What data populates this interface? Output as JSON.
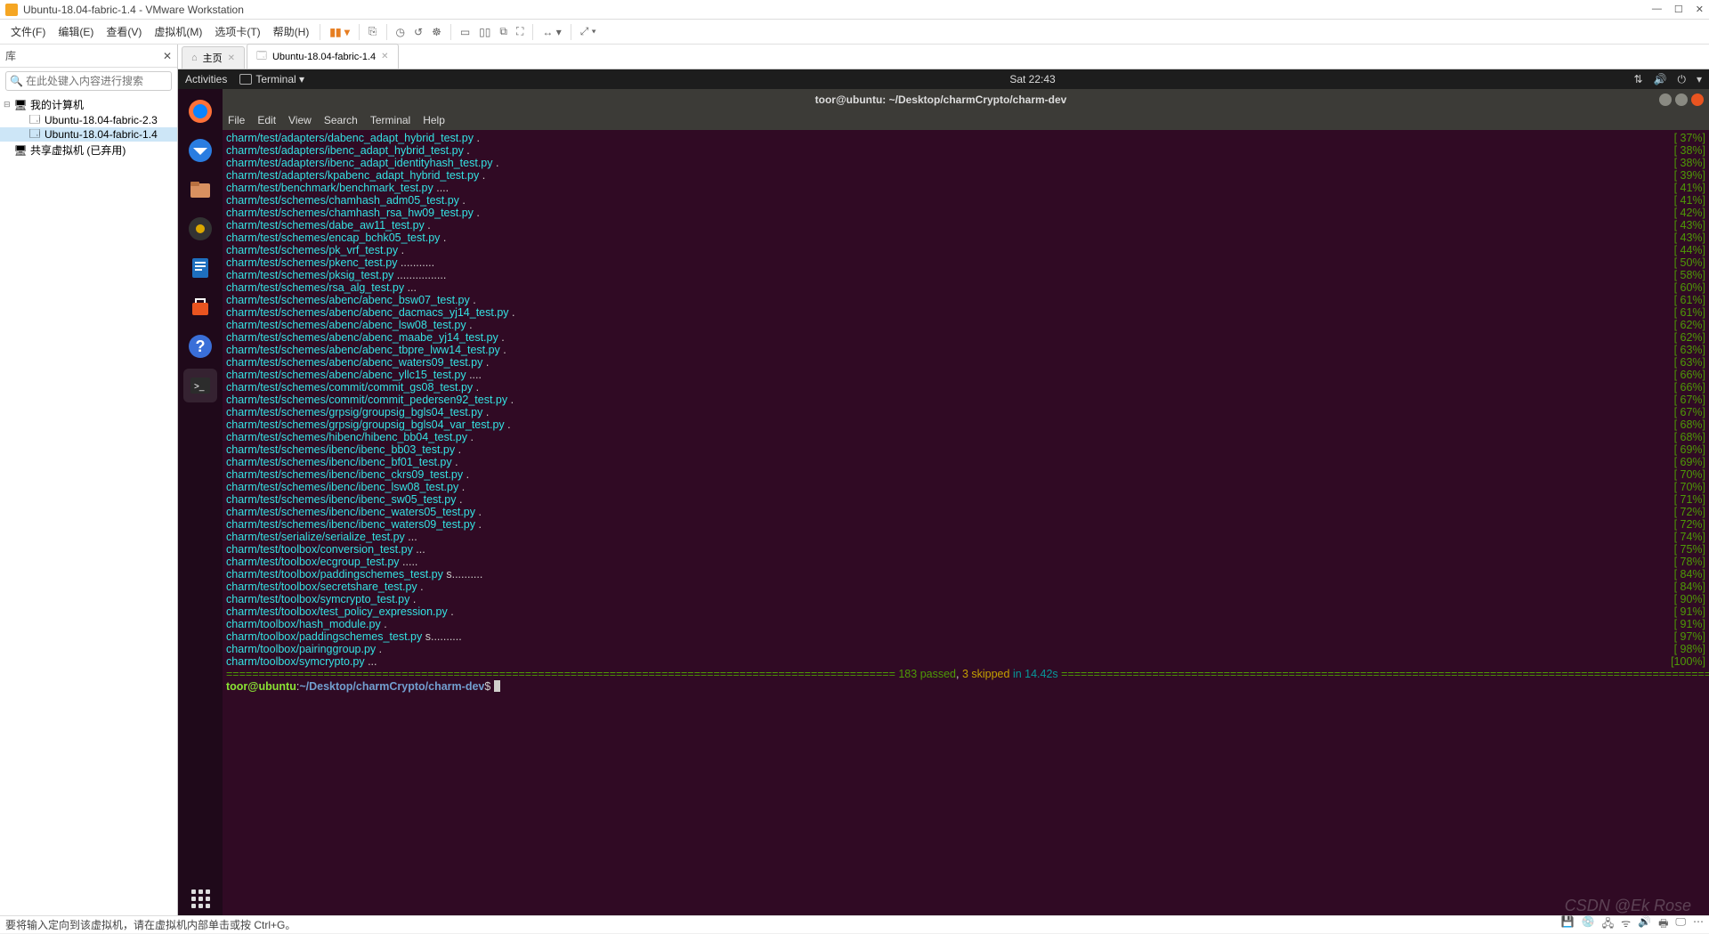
{
  "vmware": {
    "title": "Ubuntu-18.04-fabric-1.4 - VMware Workstation",
    "menu": [
      "文件(F)",
      "编辑(E)",
      "查看(V)",
      "虚拟机(M)",
      "选项卡(T)",
      "帮助(H)"
    ]
  },
  "sidebar": {
    "title": "库",
    "search_placeholder": "在此处键入内容进行搜索",
    "nodes": [
      {
        "indent": 0,
        "tw": "⊟",
        "icon": "pc",
        "label": "我的计算机"
      },
      {
        "indent": 1,
        "tw": "",
        "icon": "vm",
        "label": "Ubuntu-18.04-fabric-2.3"
      },
      {
        "indent": 1,
        "tw": "",
        "icon": "vm",
        "label": "Ubuntu-18.04-fabric-1.4",
        "sel": true
      },
      {
        "indent": 0,
        "tw": "",
        "icon": "pc",
        "label": "共享虚拟机 (已弃用)"
      }
    ]
  },
  "tabs": [
    {
      "icon": "home",
      "label": "主页",
      "active": false
    },
    {
      "icon": "vm",
      "label": "Ubuntu-18.04-fabric-1.4",
      "active": true
    }
  ],
  "ubuntu": {
    "activities": "Activities",
    "terminal_tag": "Terminal ▾",
    "clock": "Sat 22:43",
    "sys_icons": [
      "network-icon",
      "sound-icon",
      "power-icon",
      "arrow-down-icon"
    ],
    "launcher": [
      "firefox",
      "thunderbird",
      "files",
      "rhythmbox",
      "writer",
      "software",
      "help",
      "terminal"
    ]
  },
  "terminal": {
    "title": "toor@ubuntu: ~/Desktop/charmCrypto/charm-dev",
    "menu": [
      "File",
      "Edit",
      "View",
      "Search",
      "Terminal",
      "Help"
    ],
    "lines": [
      {
        "p": "charm/test/adapters/dabenc_adapt_hybrid_test.py",
        "d": " .",
        "r": "[ 37%]"
      },
      {
        "p": "charm/test/adapters/ibenc_adapt_hybrid_test.py",
        "d": " .",
        "r": "[ 38%]"
      },
      {
        "p": "charm/test/adapters/ibenc_adapt_identityhash_test.py",
        "d": " .",
        "r": "[ 38%]"
      },
      {
        "p": "charm/test/adapters/kpabenc_adapt_hybrid_test.py",
        "d": " .",
        "r": "[ 39%]"
      },
      {
        "p": "charm/test/benchmark/benchmark_test.py",
        "d": " ....",
        "r": "[ 41%]"
      },
      {
        "p": "charm/test/schemes/chamhash_adm05_test.py",
        "d": " .",
        "r": "[ 41%]"
      },
      {
        "p": "charm/test/schemes/chamhash_rsa_hw09_test.py",
        "d": " .",
        "r": "[ 42%]"
      },
      {
        "p": "charm/test/schemes/dabe_aw11_test.py",
        "d": " .",
        "r": "[ 43%]"
      },
      {
        "p": "charm/test/schemes/encap_bchk05_test.py",
        "d": " .",
        "r": "[ 43%]"
      },
      {
        "p": "charm/test/schemes/pk_vrf_test.py",
        "d": " .",
        "r": "[ 44%]"
      },
      {
        "p": "charm/test/schemes/pkenc_test.py",
        "d": " ...........",
        "r": "[ 50%]"
      },
      {
        "p": "charm/test/schemes/pksig_test.py",
        "d": " ................",
        "r": "[ 58%]"
      },
      {
        "p": "charm/test/schemes/rsa_alg_test.py",
        "d": " ...",
        "r": "[ 60%]"
      },
      {
        "p": "charm/test/schemes/abenc/abenc_bsw07_test.py",
        "d": " .",
        "r": "[ 61%]"
      },
      {
        "p": "charm/test/schemes/abenc/abenc_dacmacs_yj14_test.py",
        "d": " .",
        "r": "[ 61%]"
      },
      {
        "p": "charm/test/schemes/abenc/abenc_lsw08_test.py",
        "d": " .",
        "r": "[ 62%]"
      },
      {
        "p": "charm/test/schemes/abenc/abenc_maabe_yj14_test.py",
        "d": " .",
        "r": "[ 62%]"
      },
      {
        "p": "charm/test/schemes/abenc/abenc_tbpre_lww14_test.py",
        "d": " .",
        "r": "[ 63%]"
      },
      {
        "p": "charm/test/schemes/abenc/abenc_waters09_test.py",
        "d": " .",
        "r": "[ 63%]"
      },
      {
        "p": "charm/test/schemes/abenc/abenc_yllc15_test.py",
        "d": " ....",
        "r": "[ 66%]"
      },
      {
        "p": "charm/test/schemes/commit/commit_gs08_test.py",
        "d": " .",
        "r": "[ 66%]"
      },
      {
        "p": "charm/test/schemes/commit/commit_pedersen92_test.py",
        "d": " .",
        "r": "[ 67%]"
      },
      {
        "p": "charm/test/schemes/grpsig/groupsig_bgls04_test.py",
        "d": " .",
        "r": "[ 67%]"
      },
      {
        "p": "charm/test/schemes/grpsig/groupsig_bgls04_var_test.py",
        "d": " .",
        "r": "[ 68%]"
      },
      {
        "p": "charm/test/schemes/hibenc/hibenc_bb04_test.py",
        "d": " .",
        "r": "[ 68%]"
      },
      {
        "p": "charm/test/schemes/ibenc/ibenc_bb03_test.py",
        "d": " .",
        "r": "[ 69%]"
      },
      {
        "p": "charm/test/schemes/ibenc/ibenc_bf01_test.py",
        "d": " .",
        "r": "[ 69%]"
      },
      {
        "p": "charm/test/schemes/ibenc/ibenc_ckrs09_test.py",
        "d": " .",
        "r": "[ 70%]"
      },
      {
        "p": "charm/test/schemes/ibenc/ibenc_lsw08_test.py",
        "d": " .",
        "r": "[ 70%]"
      },
      {
        "p": "charm/test/schemes/ibenc/ibenc_sw05_test.py",
        "d": " .",
        "r": "[ 71%]"
      },
      {
        "p": "charm/test/schemes/ibenc/ibenc_waters05_test.py",
        "d": " .",
        "r": "[ 72%]"
      },
      {
        "p": "charm/test/schemes/ibenc/ibenc_waters09_test.py",
        "d": " .",
        "r": "[ 72%]"
      },
      {
        "p": "charm/test/serialize/serialize_test.py",
        "d": " ...",
        "r": "[ 74%]"
      },
      {
        "p": "charm/test/toolbox/conversion_test.py",
        "d": " ...",
        "r": "[ 75%]"
      },
      {
        "p": "charm/test/toolbox/ecgroup_test.py",
        "d": " .....",
        "r": "[ 78%]"
      },
      {
        "p": "charm/test/toolbox/paddingschemes_test.py",
        "d": " s..........",
        "r": "[ 84%]"
      },
      {
        "p": "charm/test/toolbox/secretshare_test.py",
        "d": " .",
        "r": "[ 84%]"
      },
      {
        "p": "charm/test/toolbox/symcrypto_test.py",
        "d": " .",
        "r": "[ 90%]"
      },
      {
        "p": "charm/test/toolbox/test_policy_expression.py",
        "d": " .",
        "r": "[ 91%]"
      },
      {
        "p": "charm/toolbox/hash_module.py",
        "d": " .",
        "r": "[ 91%]"
      },
      {
        "p": "charm/toolbox/paddingschemes_test.py",
        "d": " s..........",
        "r": "[ 97%]"
      },
      {
        "p": "charm/toolbox/pairinggroup.py",
        "d": " .",
        "r": "[ 98%]"
      },
      {
        "p": "charm/toolbox/symcrypto.py",
        "d": " ...",
        "r": "[100%]"
      }
    ],
    "summary": {
      "passed": "183 passed",
      "skipped": "3 skipped",
      "duration": "in 14.42s"
    },
    "prompt_user": "toor@ubuntu",
    "prompt_path": "~/Desktop/charmCrypto/charm-dev",
    "prompt_suffix": "$"
  },
  "status": {
    "text": "要将输入定向到该虚拟机，请在虚拟机内部单击或按 Ctrl+G。"
  },
  "watermark": "CSDN @Ek Rose"
}
